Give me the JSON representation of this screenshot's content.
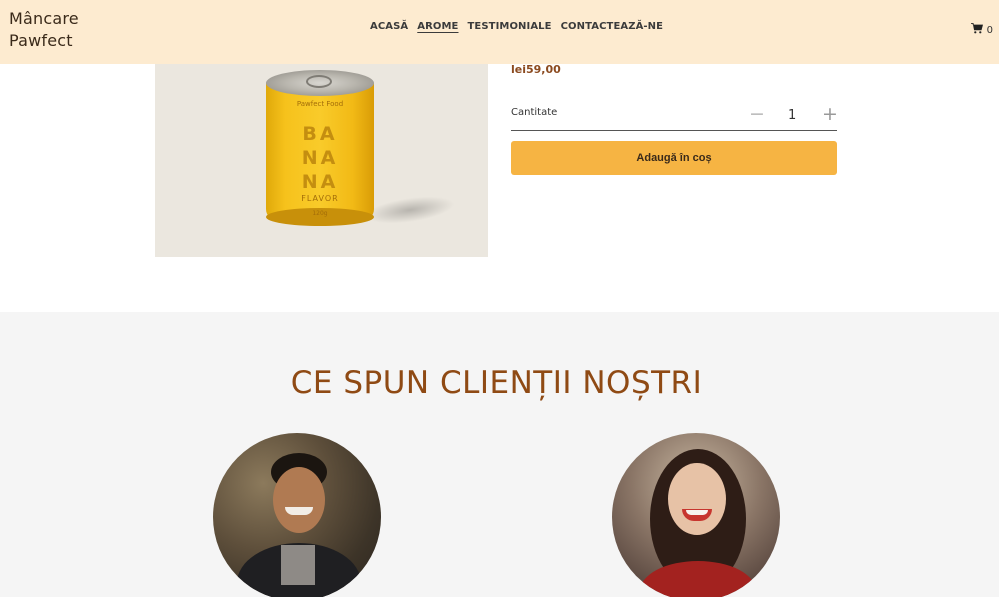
{
  "header": {
    "brand": "Mâncare Pawfect",
    "nav": [
      "ACASĂ",
      "AROME",
      "TESTIMONIALE",
      "CONTACTEAZĂ-NE"
    ],
    "active_nav": "AROME",
    "cart_count": "0",
    "cart_icon": "shopping-cart-icon"
  },
  "product": {
    "image_label": {
      "brand": "Pawfect Food",
      "name_lines": [
        "BA",
        "NA",
        "NA"
      ],
      "flavor": "FLAVOR",
      "weight": "120g"
    },
    "price": "lei59,00",
    "quantity_label": "Cantitate",
    "quantity_value": "1",
    "minus_symbol": "−",
    "plus_symbol": "+",
    "add_to_cart": "Adaugă în coș"
  },
  "testimonials": {
    "title": "CE SPUN CLIENȚII NOȘTRI"
  },
  "colors": {
    "header_bg": "#fdebd0",
    "accent_button": "#f6b443",
    "title_brown": "#8f4a14",
    "price_brown": "#8b4a1f"
  }
}
